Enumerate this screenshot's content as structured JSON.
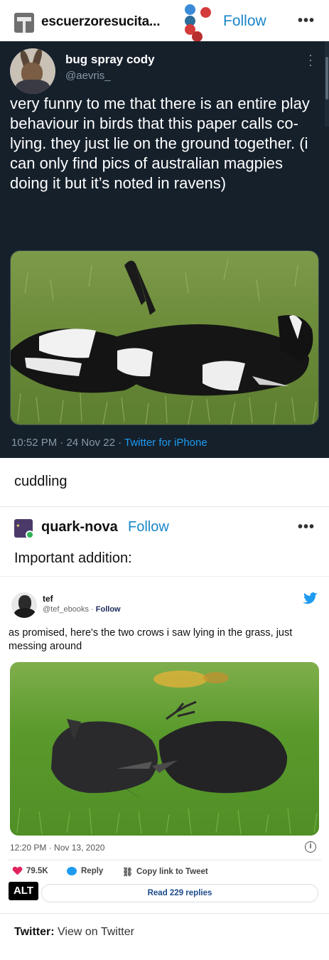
{
  "tumblr_header": {
    "username": "escuerzoresucita...",
    "follow_label": "Follow",
    "more_label": "•••",
    "follow_color": "#1a86c8"
  },
  "original_tweet": {
    "display_name": "bug spray cody",
    "handle": "@aevris_",
    "text": "very funny to me that there is an entire play behaviour in birds that this paper calls co-lying. they just lie on the ground together. (i can only find pics of australian magpies doing it but it’s noted in ravens)",
    "timestamp": "10:52 PM · 24 Nov 22 · ",
    "source": "Twitter for iPhone",
    "theme_bg": "#15202b"
  },
  "reblog_comment": "cuddling",
  "second_reblog": {
    "username": "quark-nova",
    "follow_label": "Follow",
    "more_label": "•••",
    "text": "Important addition:"
  },
  "embedded_tweet": {
    "display_name": "tef",
    "handle": "@tef_ebooks",
    "follow_label": "Follow",
    "text": "as promised, here's the two crows i saw lying in the grass, just messing around",
    "timestamp": "12:20 PM · Nov 13, 2020",
    "info_label": "i",
    "likes": "79.5K",
    "reply_label": "Reply",
    "copy_link_label": "Copy link to Tweet",
    "read_replies_label": "Read 229 replies"
  },
  "alt_badge": "ALT",
  "footer": {
    "source_prefix": "Twitter:",
    "source_text": " View on Twitter"
  }
}
